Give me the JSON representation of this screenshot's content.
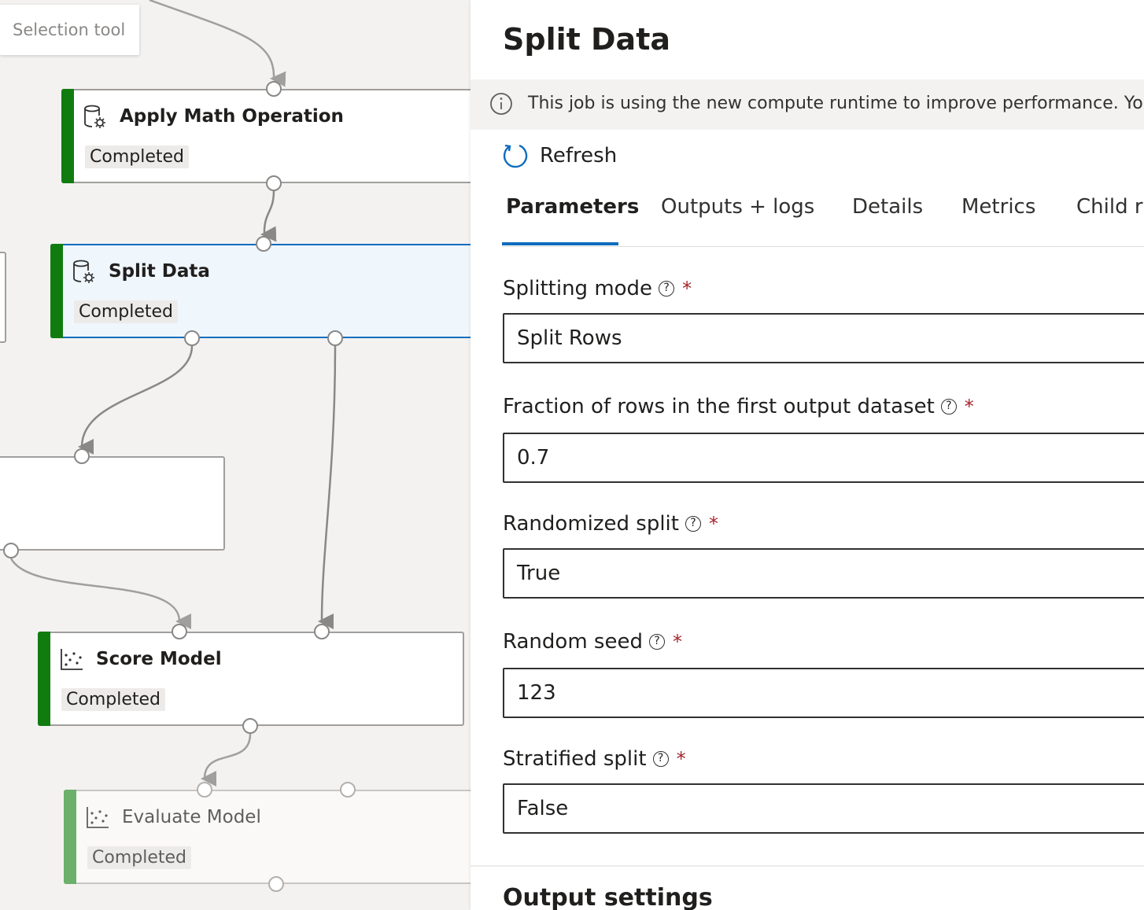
{
  "canvas": {
    "tooltip": "Selection tool",
    "nodes": [
      {
        "title": "Apply Math Operation",
        "status": "Completed"
      },
      {
        "title": "Split Data",
        "status": "Completed"
      },
      {
        "title": "Score Model",
        "status": "Completed"
      },
      {
        "title": "Evaluate Model",
        "status": "Completed"
      }
    ]
  },
  "panel": {
    "title": "Split Data",
    "banner": "This job is using the new compute runtime to improve performance. You c",
    "refresh_label": "Refresh",
    "tabs": [
      "Parameters",
      "Outputs + logs",
      "Details",
      "Metrics",
      "Child ru"
    ],
    "active_tab": "Parameters",
    "fields": [
      {
        "label": "Splitting mode",
        "value": "Split Rows"
      },
      {
        "label": "Fraction of rows in the first output dataset",
        "value": "0.7"
      },
      {
        "label": "Randomized split",
        "value": "True"
      },
      {
        "label": "Random seed",
        "value": "123"
      },
      {
        "label": "Stratified split",
        "value": "False"
      }
    ],
    "required_mark": "*",
    "help_glyph": "?",
    "section_title": "Output settings"
  },
  "colors": {
    "accent": "#0f6cbd",
    "completed": "#107c10",
    "required": "#a4262c"
  }
}
